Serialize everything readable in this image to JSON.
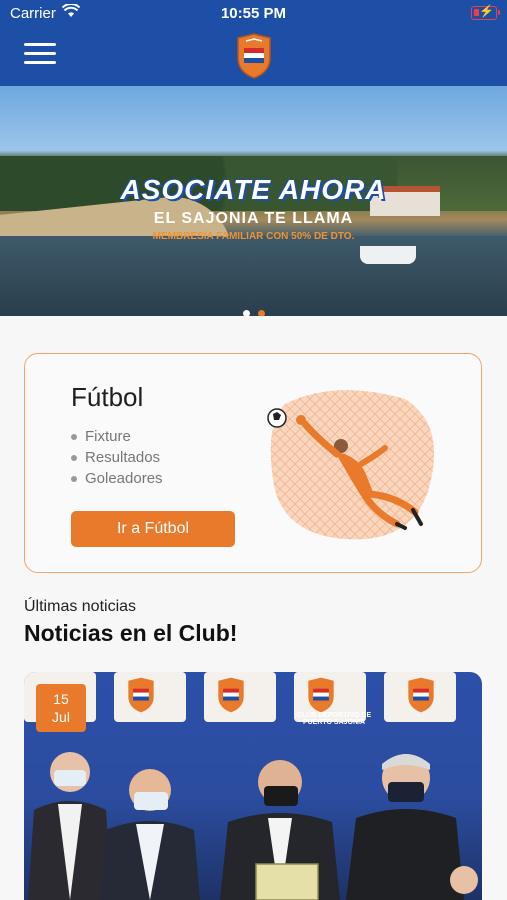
{
  "status_bar": {
    "carrier": "Carrier",
    "time": "10:55 PM"
  },
  "banner": {
    "headline": "ASOCIATE AHORA",
    "subheadline": "EL SAJONIA TE LLAMA",
    "promo": "MEMBRESÍA FAMILIAR CON 50% DE DTO.",
    "slides": 2,
    "active_slide": 2
  },
  "futbol_card": {
    "title": "Fútbol",
    "items": [
      "Fixture",
      "Resultados",
      "Goleadores"
    ],
    "button_label": "Ir a Fútbol"
  },
  "news": {
    "section_subtitle": "Últimas noticias",
    "section_title": "Noticias en el Club!",
    "first_item": {
      "day": "15",
      "month": "Jul",
      "backdrop_text": "CLUB DEPORTIVO DE PUERTO SAJONIA"
    }
  },
  "colors": {
    "brand_blue": "#1e4fa6",
    "accent_orange": "#ea7a2b",
    "card_border": "#f2a46b"
  },
  "icons": {
    "menu": "hamburger-icon",
    "wifi": "wifi-icon",
    "battery": "battery-charging-icon",
    "logo": "club-crest-logo"
  }
}
